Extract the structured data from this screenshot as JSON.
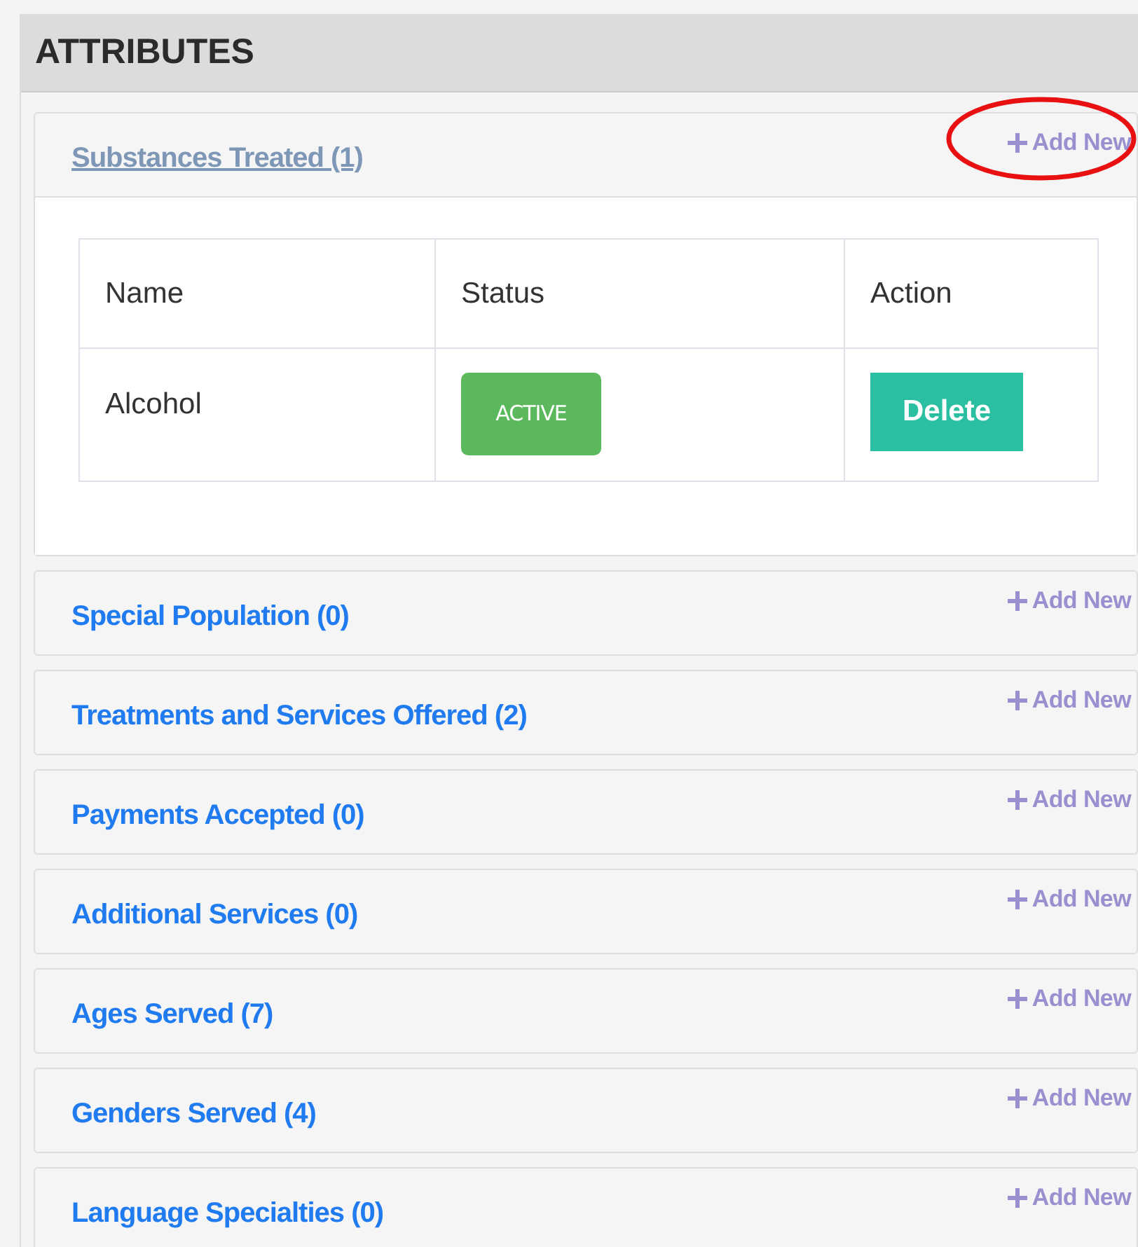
{
  "panel": {
    "title": "ATTRIBUTES"
  },
  "sections": [
    {
      "title": "Substances Treated (1)",
      "add_label": "Add New",
      "expanded": true,
      "highlighted": true,
      "table": {
        "columns": [
          "Name",
          "Status",
          "Action"
        ],
        "rows": [
          {
            "name": "Alcohol",
            "status": "ACTIVE",
            "action": "Delete"
          }
        ]
      }
    },
    {
      "title": "Special Population (0)",
      "add_label": "Add New",
      "expanded": false,
      "highlighted": false
    },
    {
      "title": "Treatments and Services Offered (2)",
      "add_label": "Add New",
      "expanded": false,
      "highlighted": false
    },
    {
      "title": "Payments Accepted (0)",
      "add_label": "Add New",
      "expanded": false,
      "highlighted": false
    },
    {
      "title": "Additional Services (0)",
      "add_label": "Add New",
      "expanded": false,
      "highlighted": false
    },
    {
      "title": "Ages Served (7)",
      "add_label": "Add New",
      "expanded": false,
      "highlighted": false
    },
    {
      "title": "Genders Served (4)",
      "add_label": "Add New",
      "expanded": false,
      "highlighted": false
    },
    {
      "title": "Language Specialties (0)",
      "add_label": "Add New",
      "expanded": false,
      "highlighted": false
    }
  ]
}
